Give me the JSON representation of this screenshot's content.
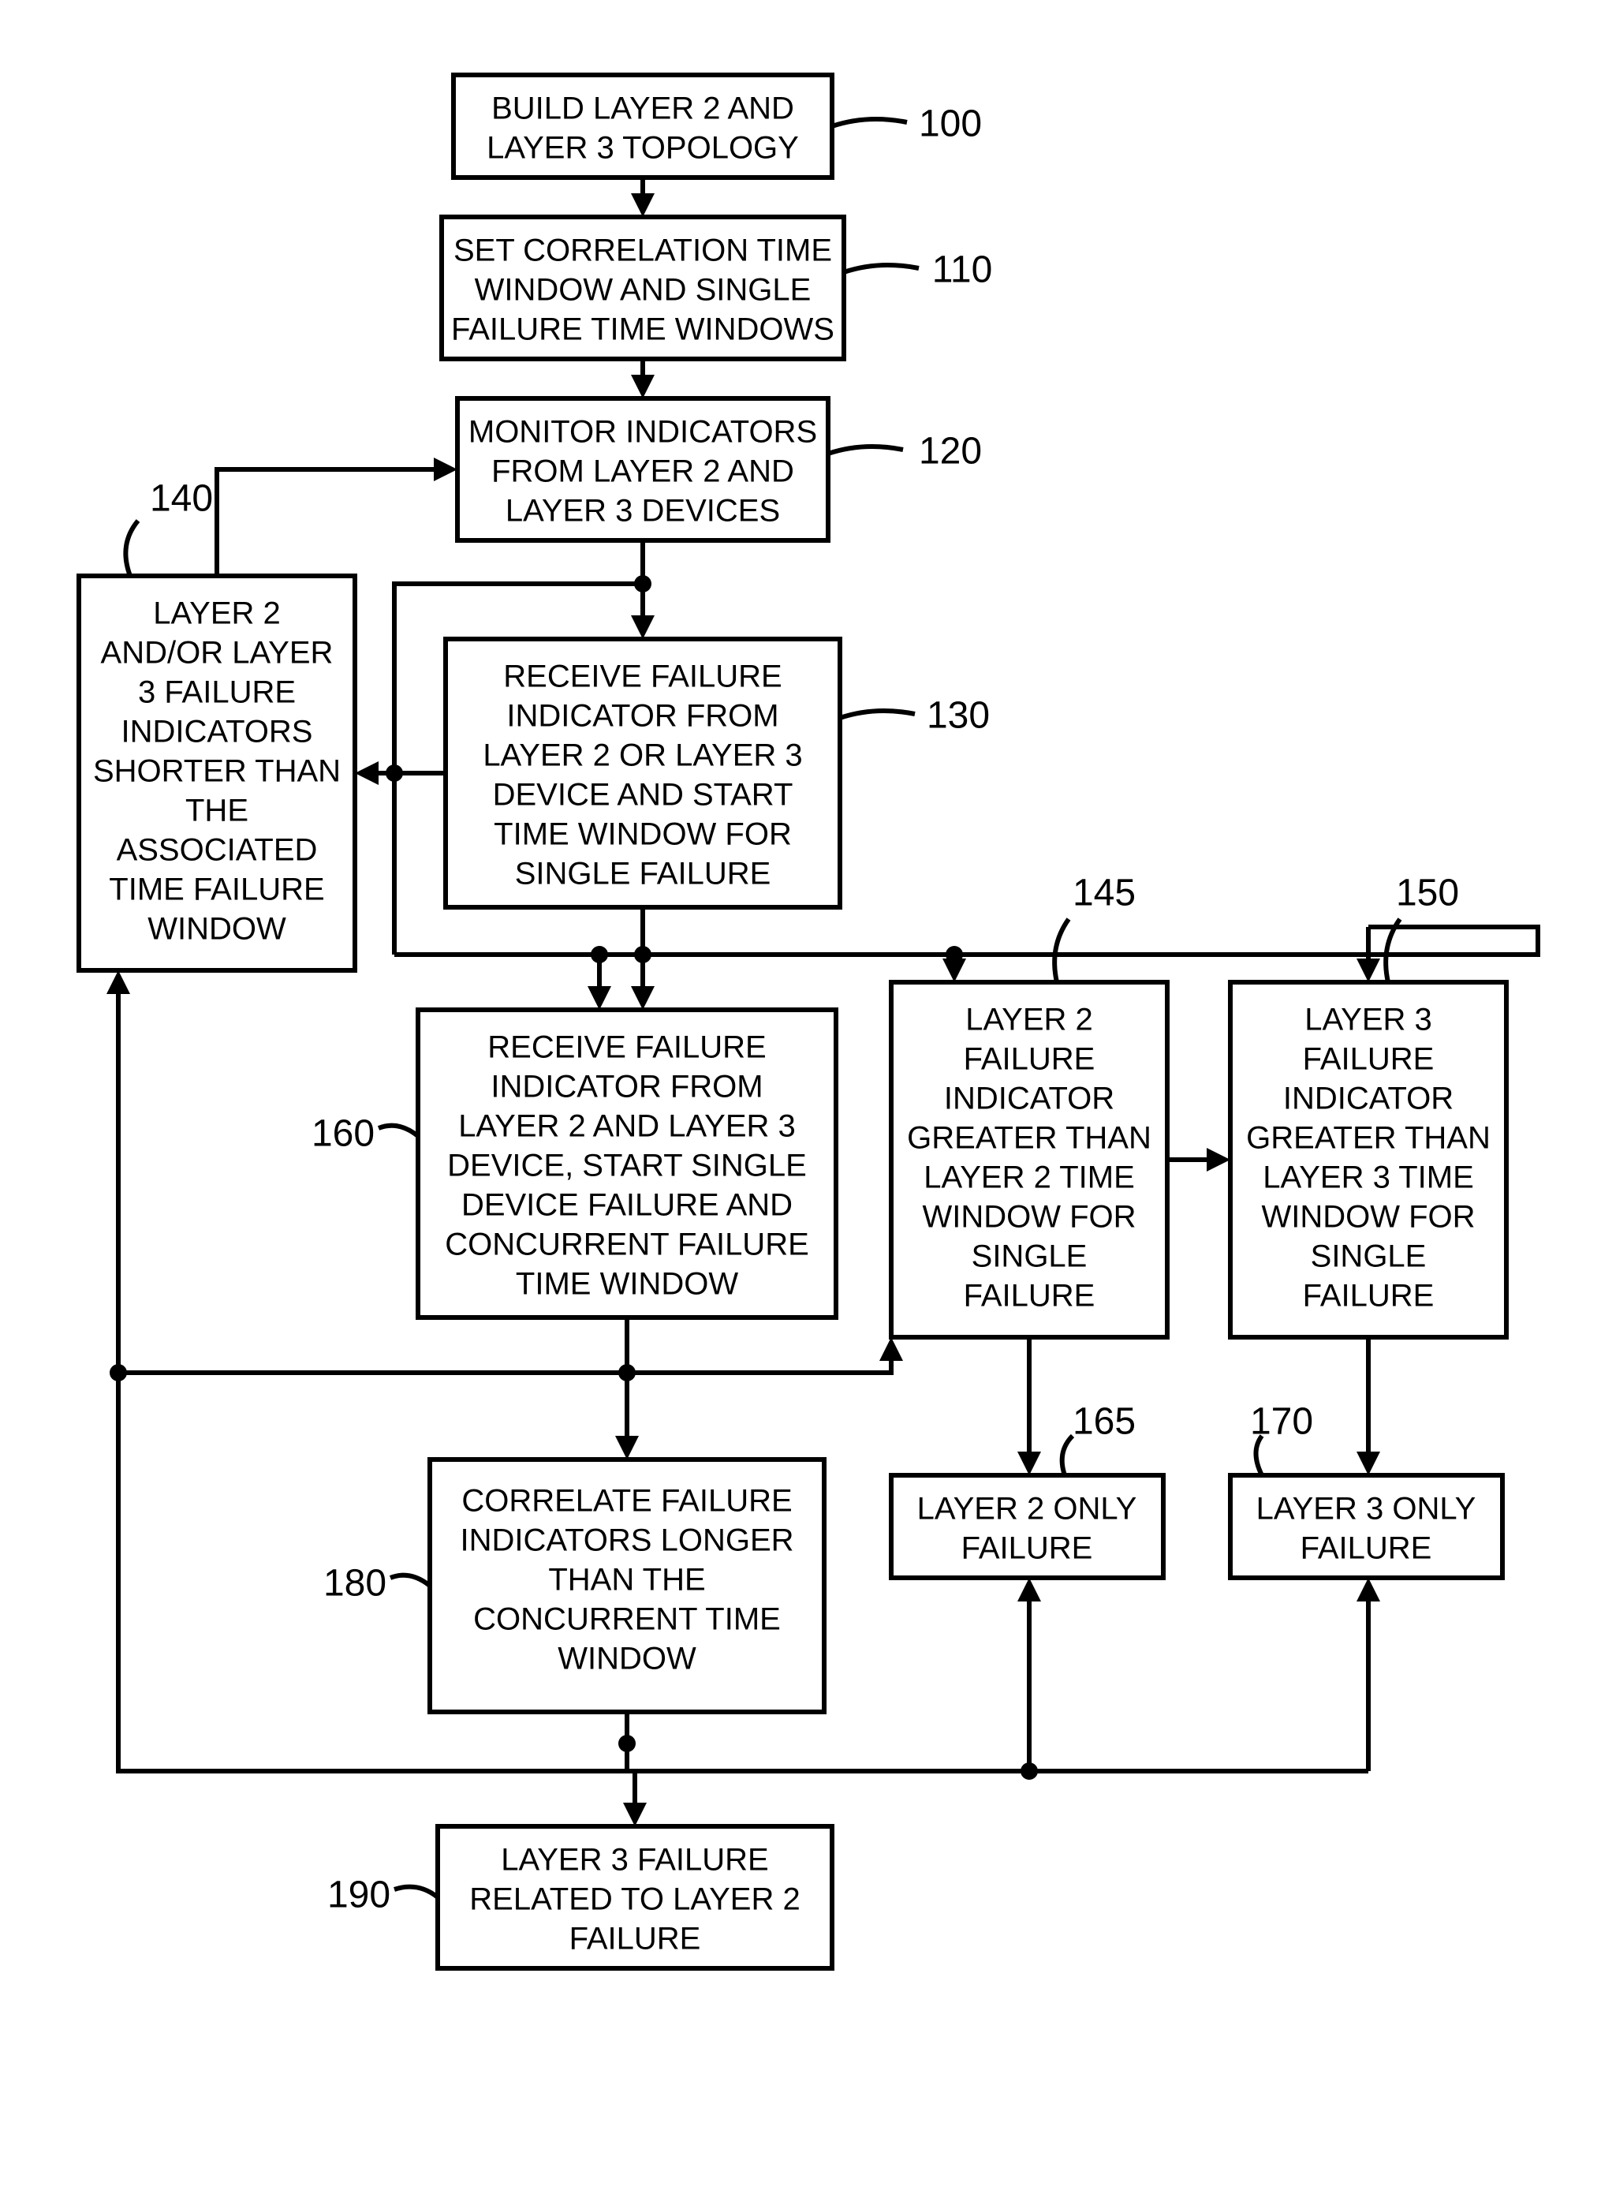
{
  "chart_data": {
    "type": "flowchart",
    "title": "",
    "nodes": [
      {
        "id": "100",
        "label": "BUILD LAYER 2 AND LAYER 3 TOPOLOGY"
      },
      {
        "id": "110",
        "label": "SET CORRELATION TIME WINDOW AND SINGLE FAILURE TIME WINDOWS"
      },
      {
        "id": "120",
        "label": "MONITOR INDICATORS FROM LAYER 2 AND LAYER 3 DEVICES"
      },
      {
        "id": "130",
        "label": "RECEIVE FAILURE INDICATOR FROM LAYER 2 OR LAYER 3 DEVICE AND START TIME WINDOW FOR SINGLE FAILURE"
      },
      {
        "id": "140",
        "label": "LAYER 2 AND/OR LAYER 3 FAILURE INDICATORS SHORTER THAN THE ASSOCIATED TIME FAILURE WINDOW"
      },
      {
        "id": "145",
        "label": "LAYER 2 FAILURE INDICATOR GREATER THAN LAYER 2 TIME WINDOW FOR SINGLE FAILURE"
      },
      {
        "id": "150",
        "label": "LAYER 3 FAILURE INDICATOR GREATER THAN LAYER 3 TIME WINDOW FOR SINGLE FAILURE"
      },
      {
        "id": "160",
        "label": "RECEIVE FAILURE INDICATOR FROM LAYER 2 AND LAYER 3 DEVICE, START SINGLE DEVICE FAILURE AND CONCURRENT FAILURE TIME WINDOW"
      },
      {
        "id": "165",
        "label": "LAYER 2 ONLY FAILURE"
      },
      {
        "id": "170",
        "label": "LAYER 3 ONLY FAILURE"
      },
      {
        "id": "180",
        "label": "CORRELATE FAILURE INDICATORS LONGER THAN THE CONCURRENT TIME WINDOW"
      },
      {
        "id": "190",
        "label": "LAYER 3 FAILURE RELATED TO LAYER 2 FAILURE"
      }
    ],
    "edges": [
      {
        "from": "100",
        "to": "110"
      },
      {
        "from": "110",
        "to": "120"
      },
      {
        "from": "120",
        "to": "130"
      },
      {
        "from": "130",
        "to": "140"
      },
      {
        "from": "140",
        "to": "120"
      },
      {
        "from": "130",
        "to": "145"
      },
      {
        "from": "130",
        "to": "150"
      },
      {
        "from": "130",
        "to": "160"
      },
      {
        "from": "160",
        "to": "140"
      },
      {
        "from": "145",
        "to": "165"
      },
      {
        "from": "150",
        "to": "170"
      },
      {
        "from": "160",
        "to": "180"
      },
      {
        "from": "180",
        "to": "190"
      },
      {
        "from": "180",
        "to": "165"
      },
      {
        "from": "180",
        "to": "170"
      },
      {
        "from": "180",
        "to": "140"
      }
    ]
  },
  "boxes": {
    "b100": {
      "l1": "BUILD LAYER 2 AND",
      "l2": "LAYER 3 TOPOLOGY"
    },
    "b110": {
      "l1": "SET CORRELATION TIME",
      "l2": "WINDOW AND SINGLE",
      "l3": "FAILURE TIME WINDOWS"
    },
    "b120": {
      "l1": "MONITOR INDICATORS",
      "l2": "FROM LAYER 2 AND",
      "l3": "LAYER 3 DEVICES"
    },
    "b130": {
      "l1": "RECEIVE FAILURE",
      "l2": "INDICATOR FROM",
      "l3": "LAYER 2 OR LAYER 3",
      "l4": "DEVICE AND START",
      "l5": "TIME WINDOW FOR",
      "l6": "SINGLE FAILURE"
    },
    "b140": {
      "l1": "LAYER 2",
      "l2": "AND/OR LAYER",
      "l3": "3 FAILURE",
      "l4": "INDICATORS",
      "l5": "SHORTER THAN",
      "l6": "THE",
      "l7": "ASSOCIATED",
      "l8": "TIME FAILURE",
      "l9": "WINDOW"
    },
    "b145": {
      "l1": "LAYER 2",
      "l2": "FAILURE",
      "l3": "INDICATOR",
      "l4": "GREATER THAN",
      "l5": "LAYER 2 TIME",
      "l6": "WINDOW FOR",
      "l7": "SINGLE",
      "l8": "FAILURE"
    },
    "b150": {
      "l1": "LAYER 3",
      "l2": "FAILURE",
      "l3": "INDICATOR",
      "l4": "GREATER THAN",
      "l5": "LAYER 3 TIME",
      "l6": "WINDOW FOR",
      "l7": "SINGLE",
      "l8": "FAILURE"
    },
    "b160": {
      "l1": "RECEIVE FAILURE",
      "l2": "INDICATOR FROM",
      "l3": "LAYER 2 AND LAYER 3",
      "l4": "DEVICE, START SINGLE",
      "l5": "DEVICE FAILURE AND",
      "l6": "CONCURRENT FAILURE",
      "l7": "TIME WINDOW"
    },
    "b165": {
      "l1": "LAYER 2 ONLY",
      "l2": "FAILURE"
    },
    "b170": {
      "l1": "LAYER 3 ONLY",
      "l2": "FAILURE"
    },
    "b180": {
      "l1": "CORRELATE FAILURE",
      "l2": "INDICATORS LONGER",
      "l3": "THAN THE",
      "l4": "CONCURRENT TIME",
      "l5": "WINDOW"
    },
    "b190": {
      "l1": "LAYER 3 FAILURE",
      "l2": "RELATED TO LAYER 2",
      "l3": "FAILURE"
    }
  },
  "labels": {
    "n100": "100",
    "n110": "110",
    "n120": "120",
    "n130": "130",
    "n140": "140",
    "n145": "145",
    "n150": "150",
    "n160": "160",
    "n165": "165",
    "n170": "170",
    "n180": "180",
    "n190": "190"
  }
}
